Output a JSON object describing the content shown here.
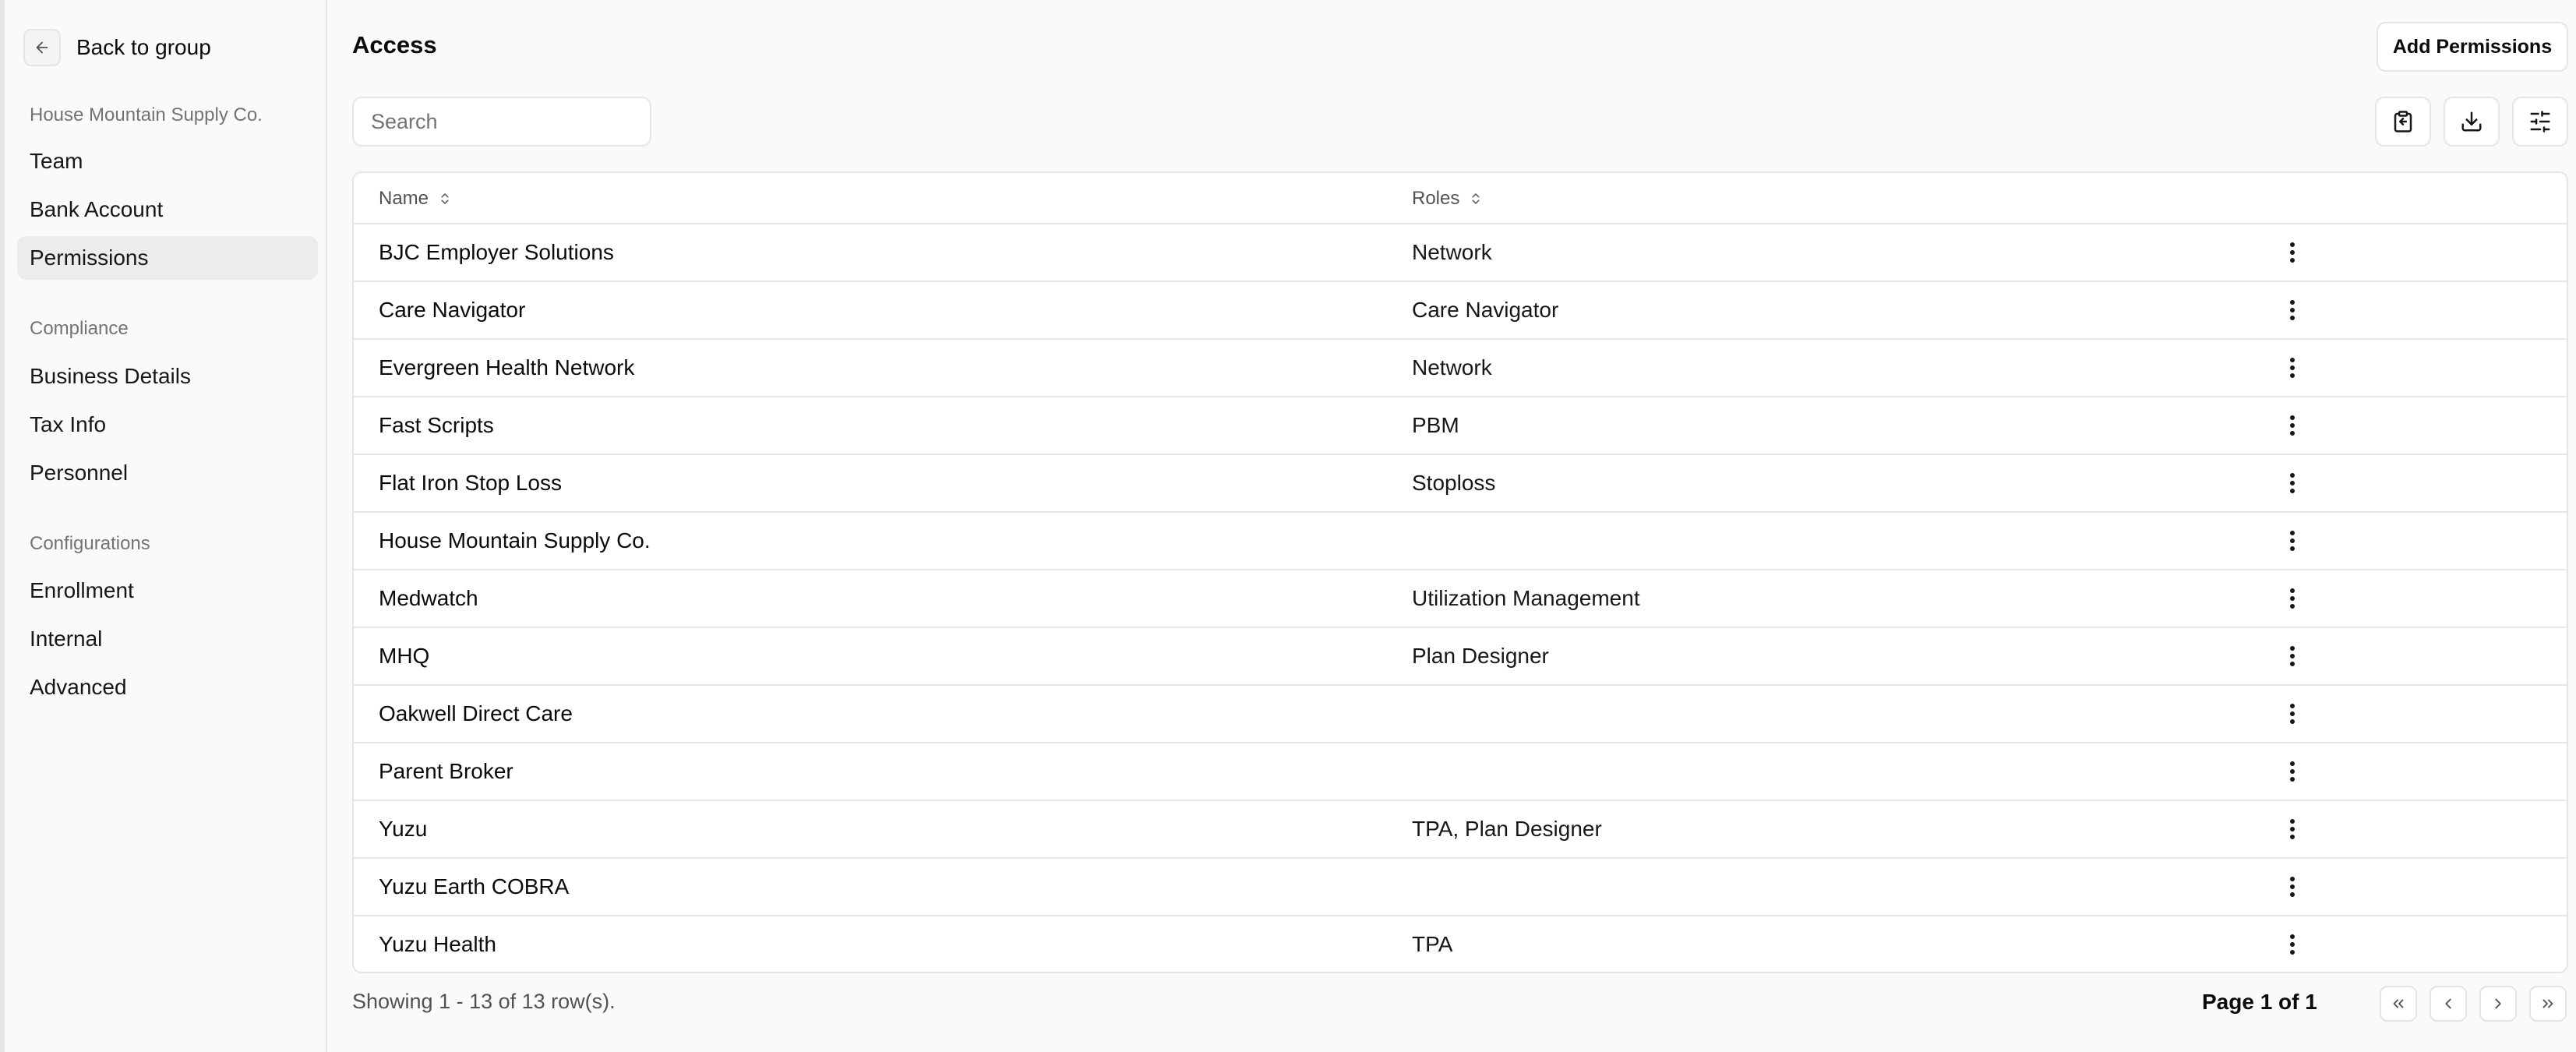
{
  "sidebar": {
    "back_label": "Back to group",
    "org_heading": "House Mountain Supply Co.",
    "org_items": [
      {
        "label": "Team"
      },
      {
        "label": "Bank Account"
      },
      {
        "label": "Permissions"
      }
    ],
    "compliance_heading": "Compliance",
    "compliance_items": [
      {
        "label": "Business Details"
      },
      {
        "label": "Tax Info"
      },
      {
        "label": "Personnel"
      }
    ],
    "config_heading": "Configurations",
    "config_items": [
      {
        "label": "Enrollment"
      },
      {
        "label": "Internal"
      },
      {
        "label": "Advanced"
      }
    ]
  },
  "main": {
    "title": "Access",
    "add_button_label": "Add Permissions",
    "search_placeholder": "Search",
    "search_value": ""
  },
  "table": {
    "columns": [
      "Name",
      "Roles"
    ],
    "rows": [
      {
        "name": "BJC Employer Solutions",
        "roles": "Network"
      },
      {
        "name": "Care Navigator",
        "roles": "Care Navigator"
      },
      {
        "name": "Evergreen Health Network",
        "roles": "Network"
      },
      {
        "name": "Fast Scripts",
        "roles": "PBM"
      },
      {
        "name": "Flat Iron Stop Loss",
        "roles": "Stoploss"
      },
      {
        "name": "House Mountain Supply Co.",
        "roles": ""
      },
      {
        "name": "Medwatch",
        "roles": "Utilization Management"
      },
      {
        "name": "MHQ",
        "roles": "Plan Designer"
      },
      {
        "name": "Oakwell Direct Care",
        "roles": ""
      },
      {
        "name": "Parent Broker",
        "roles": ""
      },
      {
        "name": "Yuzu",
        "roles": "TPA, Plan Designer"
      },
      {
        "name": "Yuzu Earth COBRA",
        "roles": ""
      },
      {
        "name": "Yuzu Health",
        "roles": "TPA"
      }
    ]
  },
  "footer": {
    "showing": "Showing 1 - 13 of 13 row(s).",
    "page": "Page 1 of 1"
  },
  "colors": {
    "background": "#fafafa",
    "border": "#e5e5e5",
    "active_nav": "#ececec",
    "muted_text": "#737373"
  },
  "icons": {
    "back": "arrow-left-icon",
    "copy": "clipboard-copy-icon",
    "download": "download-icon",
    "filters": "sliders-icon",
    "sort": "chevrons-up-down-icon",
    "row_menu": "more-vertical-icon",
    "first": "chevrons-left-icon",
    "prev": "chevron-left-icon",
    "next": "chevron-right-icon",
    "last": "chevrons-right-icon"
  }
}
